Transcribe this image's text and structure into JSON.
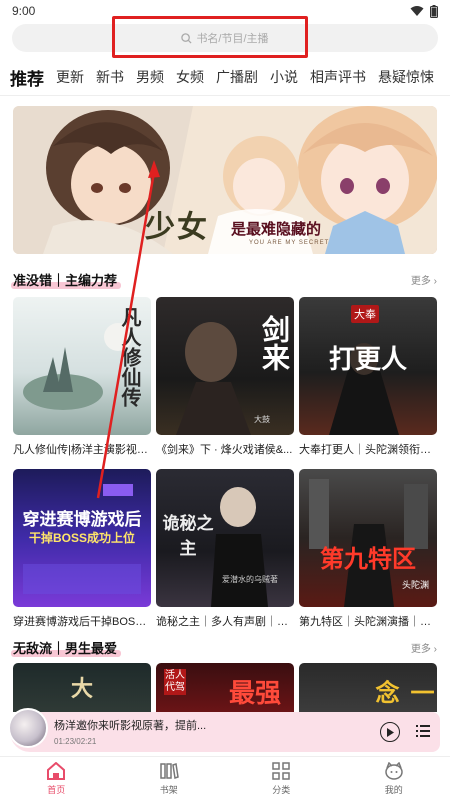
{
  "status": {
    "time": "9:00"
  },
  "search": {
    "placeholder": "书名/节目/主播"
  },
  "tabs": [
    "推荐",
    "更新",
    "新书",
    "男频",
    "女频",
    "广播剧",
    "小说",
    "相声评书",
    "悬疑惊悚"
  ],
  "banner": {
    "title": "少女",
    "subtitle": "是最难隐藏的",
    "english": "YOU ARE MY SECRET"
  },
  "sections": [
    {
      "title": "准没错｜主编力荐",
      "more": "更多",
      "items": [
        {
          "title": "凡人修仙传|杨洋主演影视原著",
          "cover_text": "凡人修仙传"
        },
        {
          "title": "《剑来》下 · 烽火戏诸侯&...",
          "cover_text": "剑来",
          "cover_sub": "大鼓"
        },
        {
          "title": "大奉打更人｜头陀渊领衔多...",
          "cover_text": "打更人",
          "cover_badge": "大奉"
        },
        {
          "title": "穿进赛博游戏后干掉BOSS...",
          "cover_text": "穿进赛博游戏后",
          "cover_text2": "干掉BOSS成功上位"
        },
        {
          "title": "诡秘之主｜多人有声剧｜同...",
          "cover_text": "诡秘之主",
          "cover_sub": "爱潜水的乌贼著"
        },
        {
          "title": "第九特区｜头陀渊演播｜搞...",
          "cover_text": "第九特区",
          "cover_sub": "头陀渊"
        }
      ]
    },
    {
      "title": "无敌流｜男生最爱",
      "more": "更多",
      "items": [
        {
          "cover_text": "大"
        },
        {
          "cover_text": "最强",
          "cover_badge": "活人",
          "cover_badge2": "代驾"
        },
        {
          "cover_text": "一念"
        }
      ]
    }
  ],
  "player": {
    "text": "杨洋邀你来听影视原著，提前...",
    "time": "01:23/02:21"
  },
  "nav": [
    {
      "label": "首页",
      "icon": "home-icon",
      "active": true
    },
    {
      "label": "书架",
      "icon": "bookshelf-icon",
      "active": false
    },
    {
      "label": "分类",
      "icon": "category-icon",
      "active": false
    },
    {
      "label": "我的",
      "icon": "profile-icon",
      "active": false
    }
  ],
  "colors": {
    "accent": "#e84c6a",
    "highlight": "#f8c7d4",
    "annotation": "#e02020"
  }
}
